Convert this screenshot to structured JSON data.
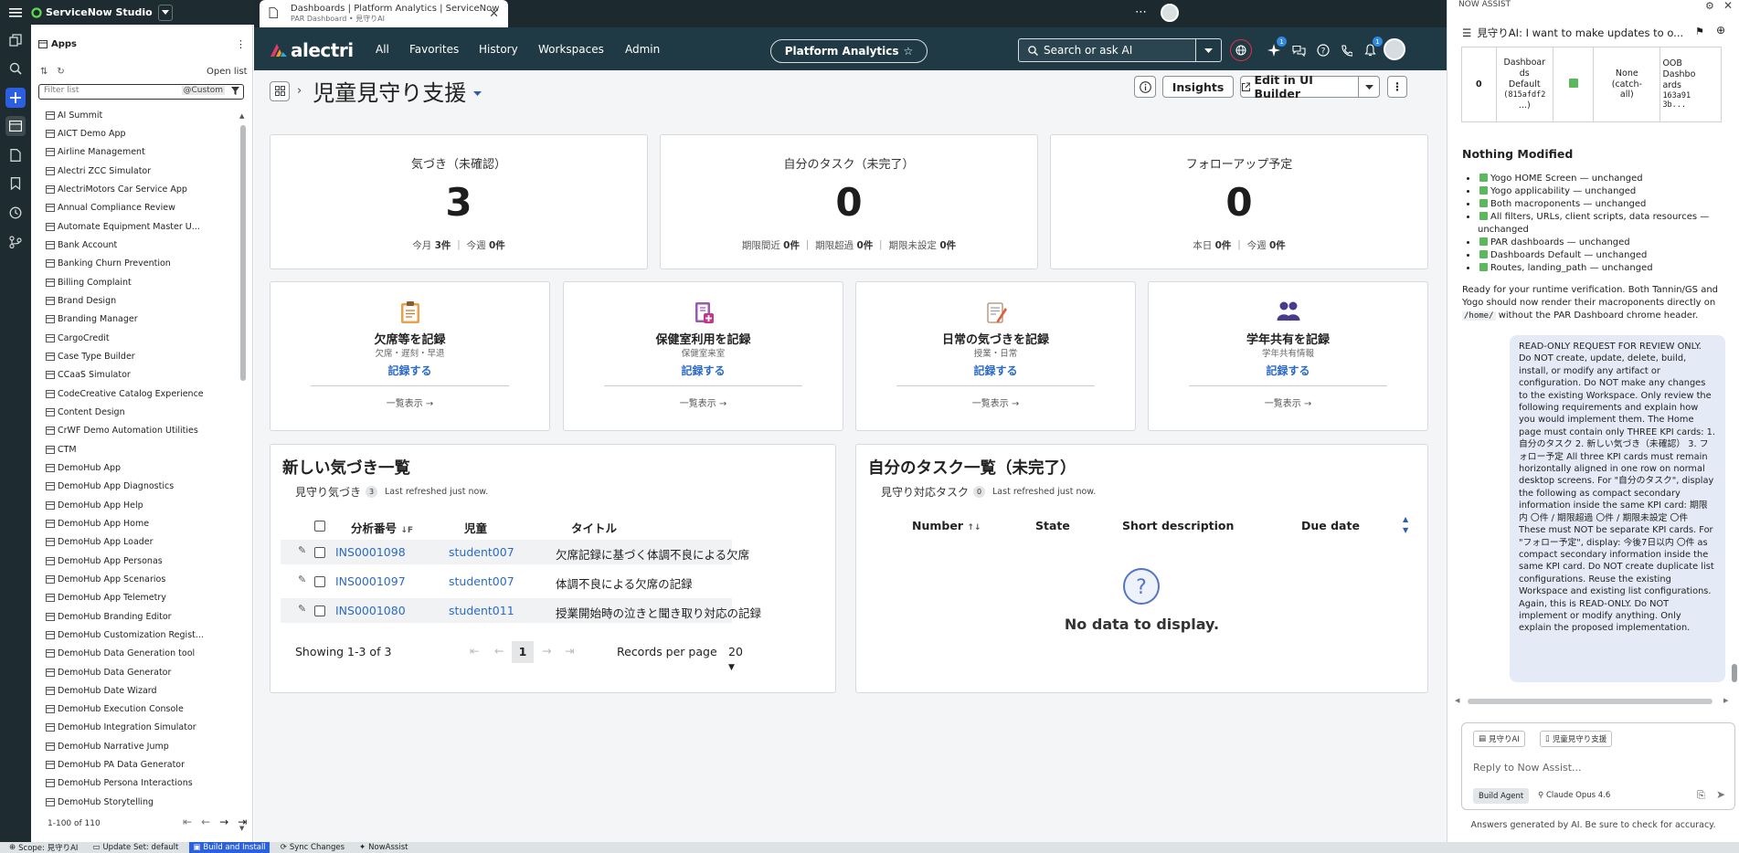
{
  "studio": {
    "title": "ServiceNow Studio"
  },
  "browser_tab": {
    "title": "Dashboards | Platform Analytics | ServiceNow",
    "subtitle": "PAR Dashboard • 見守りAI"
  },
  "apps_panel": {
    "title": "Apps",
    "open_list": "Open list",
    "filter_placeholder": "Filter list",
    "filter_tag": "@Custom",
    "items": [
      "AI Summit",
      "AICT Demo App",
      "Airline Management",
      "Alectri ZCC Simulator",
      "AlectriMotors Car Service App",
      "Annual Compliance Review",
      "Automate Equipment Master U...",
      "Bank Account",
      "Banking Churn Prevention",
      "Billing Complaint",
      "Brand Design",
      "Branding Manager",
      "CargoCredit",
      "Case Type Builder",
      "CCaaS Simulator",
      "CodeCreative Catalog Experience",
      "Content Design",
      "CrWF Demo Automation Utilities",
      "CTM",
      "DemoHub App",
      "DemoHub App Diagnostics",
      "DemoHub App Help",
      "DemoHub App Home",
      "DemoHub App Loader",
      "DemoHub App Personas",
      "DemoHub App Scenarios",
      "DemoHub App Telemetry",
      "DemoHub Branding Editor",
      "DemoHub Customization Regist...",
      "DemoHub Data Generation tool",
      "DemoHub Data Generator",
      "DemoHub Date Wizard",
      "DemoHub Execution Console",
      "DemoHub Integration Simulator",
      "DemoHub Narrative Jump",
      "DemoHub PA Data Generator",
      "DemoHub Persona Interactions",
      "DemoHub Storytelling"
    ],
    "range": "1-100 of 110"
  },
  "statusbar": {
    "scope": "Scope: 見守りAI",
    "update_set": "Update Set: default",
    "build": "Build and Install",
    "sync": "Sync Changes",
    "nowassist": "NowAssist"
  },
  "header": {
    "logo": "alectri",
    "nav": [
      "All",
      "Favorites",
      "History",
      "Workspaces",
      "Admin"
    ],
    "pill": "Platform Analytics",
    "search": "Search or ask AI",
    "badge_ai": "1",
    "badge_bell": "1"
  },
  "dashboard": {
    "title": "児童見守り支援",
    "insights": "Insights",
    "edit": "Edit in UI Builder",
    "kpis": [
      {
        "title": "気づき（未確認）",
        "value": "3",
        "sub": [
          [
            "今月",
            "3件"
          ],
          [
            "今週",
            "0件"
          ]
        ]
      },
      {
        "title": "自分のタスク（未完了）",
        "value": "0",
        "sub": [
          [
            "期限間近",
            "0件"
          ],
          [
            "期限超過",
            "0件"
          ],
          [
            "期限未設定",
            "0件"
          ]
        ]
      },
      {
        "title": "フォローアップ予定",
        "value": "0",
        "sub": [
          [
            "本日",
            "0件"
          ],
          [
            "今週",
            "0件"
          ]
        ]
      }
    ],
    "actions": [
      {
        "title": "欠席等を記録",
        "sub": "欠席・遅刻・早退",
        "link": "記録する",
        "more": "一覧表示 →",
        "icon": "clipboard-icon"
      },
      {
        "title": "保健室利用を記録",
        "sub": "保健室来室",
        "link": "記録する",
        "more": "一覧表示 →",
        "icon": "medical-kit-icon"
      },
      {
        "title": "日常の気づきを記録",
        "sub": "授業・日常",
        "link": "記録する",
        "more": "一覧表示 →",
        "icon": "notepad-icon"
      },
      {
        "title": "学年共有を記録",
        "sub": "学年共有情報",
        "link": "記録する",
        "more": "一覧表示 →",
        "icon": "people-icon"
      }
    ],
    "insights_list": {
      "title": "新しい気づき一覧",
      "sub": "見守り気づき",
      "count": "3",
      "refreshed": "Last refreshed just now.",
      "columns": [
        "分析番号",
        "児童",
        "タイトル"
      ],
      "rows": [
        {
          "number": "INS0001098",
          "student": "student007",
          "title": "欠席記録に基づく体調不良による欠席"
        },
        {
          "number": "INS0001097",
          "student": "student007",
          "title": "体調不良による欠席の記録"
        },
        {
          "number": "INS0001080",
          "student": "student011",
          "title": "授業開始時の泣きと聞き取り対応の記録"
        }
      ],
      "showing": "Showing 1-3 of 3",
      "page": "1",
      "rpp_label": "Records per page",
      "rpp": "20"
    },
    "tasks_list": {
      "title": "自分のタスク一覧（未完了）",
      "sub": "見守り対応タスク",
      "count": "0",
      "refreshed": "Last refreshed just now.",
      "columns": [
        "Number",
        "State",
        "Short description",
        "Due date"
      ],
      "empty": "No data to display."
    }
  },
  "now_assist": {
    "label": "NOW ASSIST",
    "chat_title": "見守りAI: I want to make updates to o...",
    "table": {
      "row_num": "0",
      "col1": [
        "Dashboar",
        "ds",
        "Default",
        "(815afdf2",
        "...)"
      ],
      "col3": [
        "None",
        "(catch-",
        "all)"
      ],
      "col4": [
        "OOB",
        "Dashbo",
        "ards",
        "163a91",
        "3b..."
      ]
    },
    "nothing_modified": "Nothing Modified",
    "unchanged": [
      "Yogo HOME Screen — unchanged",
      "Yogo applicability — unchanged",
      "Both macroponents — unchanged",
      "All filters, URLs, client scripts, data resources — unchanged",
      "PAR dashboards — unchanged",
      "Dashboards Default — unchanged",
      "Routes, landing_path — unchanged"
    ],
    "ready_pre": "Ready for your runtime verification. Both Tannin/GS and Yogo should now render their macroponents directly on",
    "ready_code": "/home/",
    "ready_post": "without the PAR Dashboard chrome header.",
    "message": "READ-ONLY REQUEST FOR REVIEW ONLY. Do NOT create, update, delete, build, install, or modify any artifact or configuration. Do NOT make any changes to the existing Workspace. Only review the following requirements and explain how you would implement them. The Home page must contain only THREE KPI cards: 1. 自分のタスク 2. 新しい気づき（未確認） 3. フォロー予定 All three KPI cards must remain horizontally aligned in one row on normal desktop screens. For \"自分のタスク\", display the following as compact secondary information inside the same KPI card: 期限内 〇件 / 期限超過 〇件 / 期限未設定 〇件 These must NOT be separate KPI cards. For \"フォロー予定\", display: 今後7日以内 〇件 as compact secondary information inside the same KPI card. Do NOT create duplicate list configurations. Reuse the existing Workspace and existing list configurations. Again, this is READ-ONLY. Do NOT implement or modify anything. Only explain the proposed implementation.",
    "chip1": "見守りAI",
    "chip2": "児童見守り支援",
    "placeholder": "Reply to Now Assist...",
    "agent": "Build Agent",
    "model": "Claude Opus 4.6",
    "disclaimer": "Answers generated by AI. Be sure to check for accuracy."
  }
}
